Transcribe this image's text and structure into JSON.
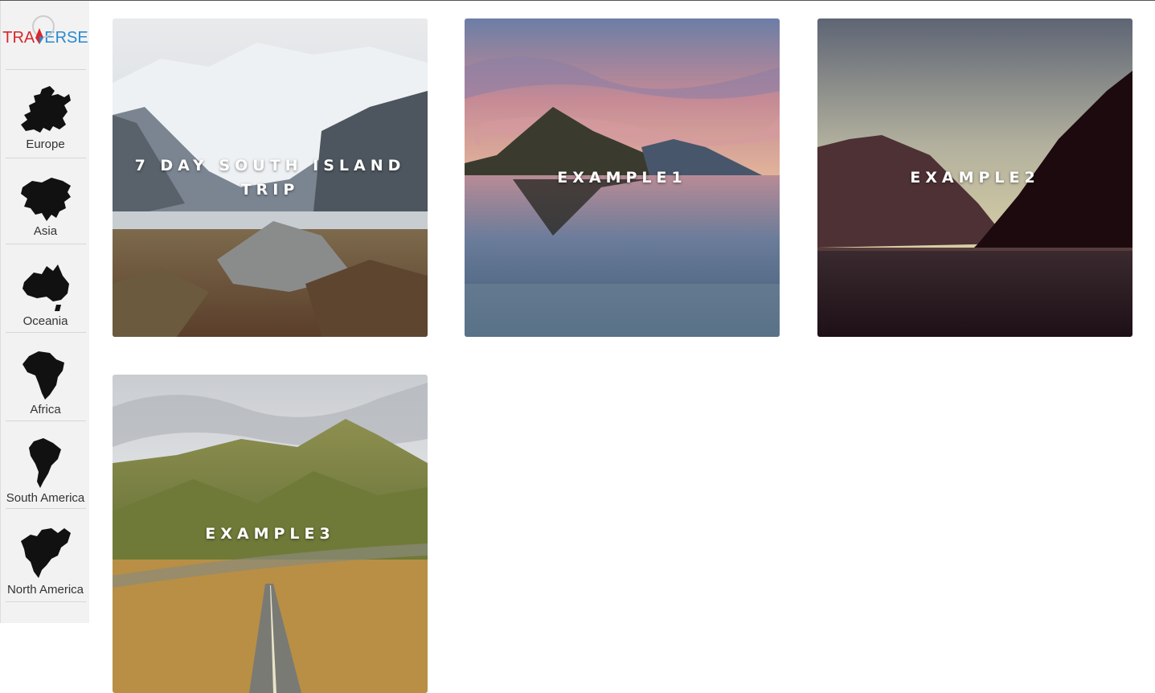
{
  "logo": {
    "part1": "TRA",
    "part2": "ERSE",
    "icon": "compass-pin-icon",
    "color_red": "#d9262b",
    "color_blue": "#2a8ad0"
  },
  "sidebar": {
    "items": [
      {
        "label": "Europe",
        "icon": "europe-map-icon"
      },
      {
        "label": "Asia",
        "icon": "asia-map-icon"
      },
      {
        "label": "Oceania",
        "icon": "oceania-map-icon"
      },
      {
        "label": "Africa",
        "icon": "africa-map-icon"
      },
      {
        "label": "South America",
        "icon": "south-america-map-icon"
      },
      {
        "label": "North America",
        "icon": "north-america-map-icon"
      }
    ]
  },
  "trips": [
    {
      "title": "7 DAY SOUTH ISLAND TRIP"
    },
    {
      "title": "EXAMPLE1"
    },
    {
      "title": "EXAMPLE2"
    },
    {
      "title": "EXAMPLE3"
    }
  ]
}
